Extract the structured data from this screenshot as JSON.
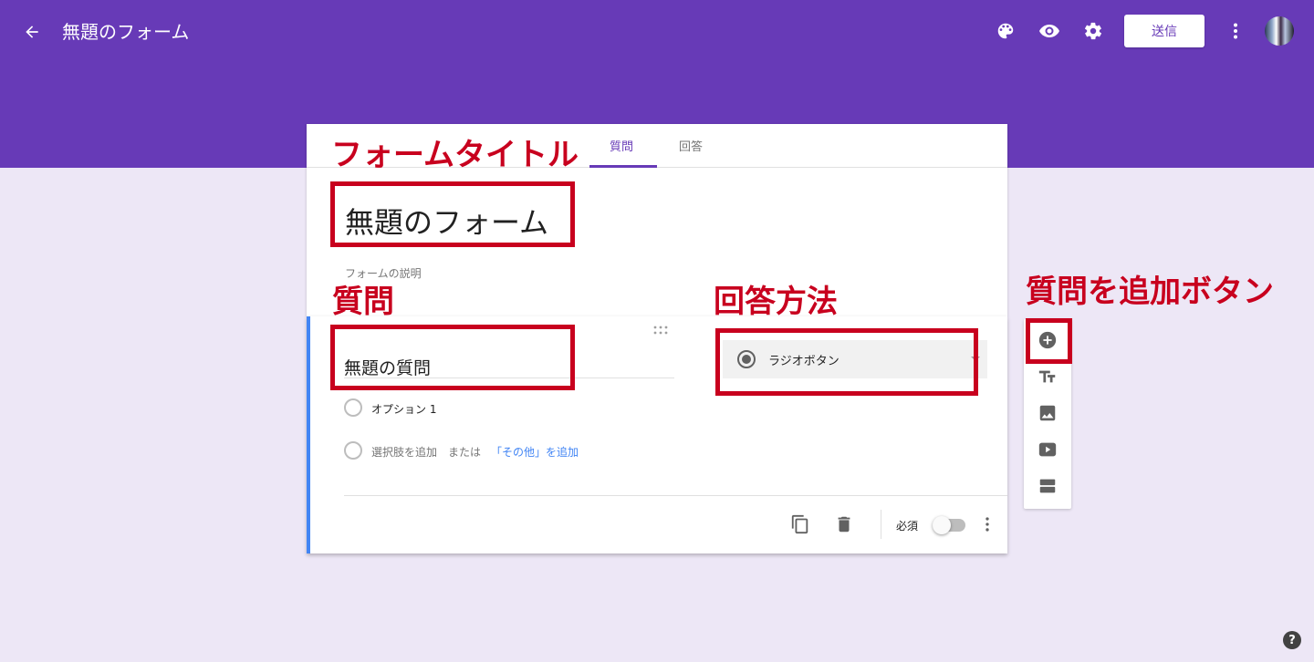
{
  "colors": {
    "header_bg": "#673ab7",
    "page_bg": "#ede7f6",
    "accent": "#673ab7",
    "question_accent": "#4285f4",
    "annotation": "#c8001e"
  },
  "header": {
    "title": "無題のフォーム",
    "send_label": "送信",
    "icons": [
      "back-arrow-icon",
      "palette-icon",
      "eye-icon",
      "gear-icon",
      "more-vert-icon"
    ]
  },
  "tabs": [
    {
      "label": "質問",
      "active": true
    },
    {
      "label": "回答",
      "active": false
    }
  ],
  "form": {
    "title": "無題のフォーム",
    "description_placeholder": "フォームの説明"
  },
  "question": {
    "title": "無題の質問",
    "type": "ラジオボタン",
    "option1": "オプション 1",
    "add_option": "選択肢を追加",
    "or_text": "または",
    "add_other": "「その他」を追加",
    "required_label": "必須",
    "required": false
  },
  "side_tools": [
    "add-question-icon",
    "add-title-icon",
    "add-image-icon",
    "add-video-icon",
    "add-section-icon"
  ],
  "annotations": {
    "form_title": "フォームタイトル",
    "question": "質問",
    "answer_type": "回答方法",
    "add_question": "質問を追加ボタン"
  },
  "help_label": "?"
}
